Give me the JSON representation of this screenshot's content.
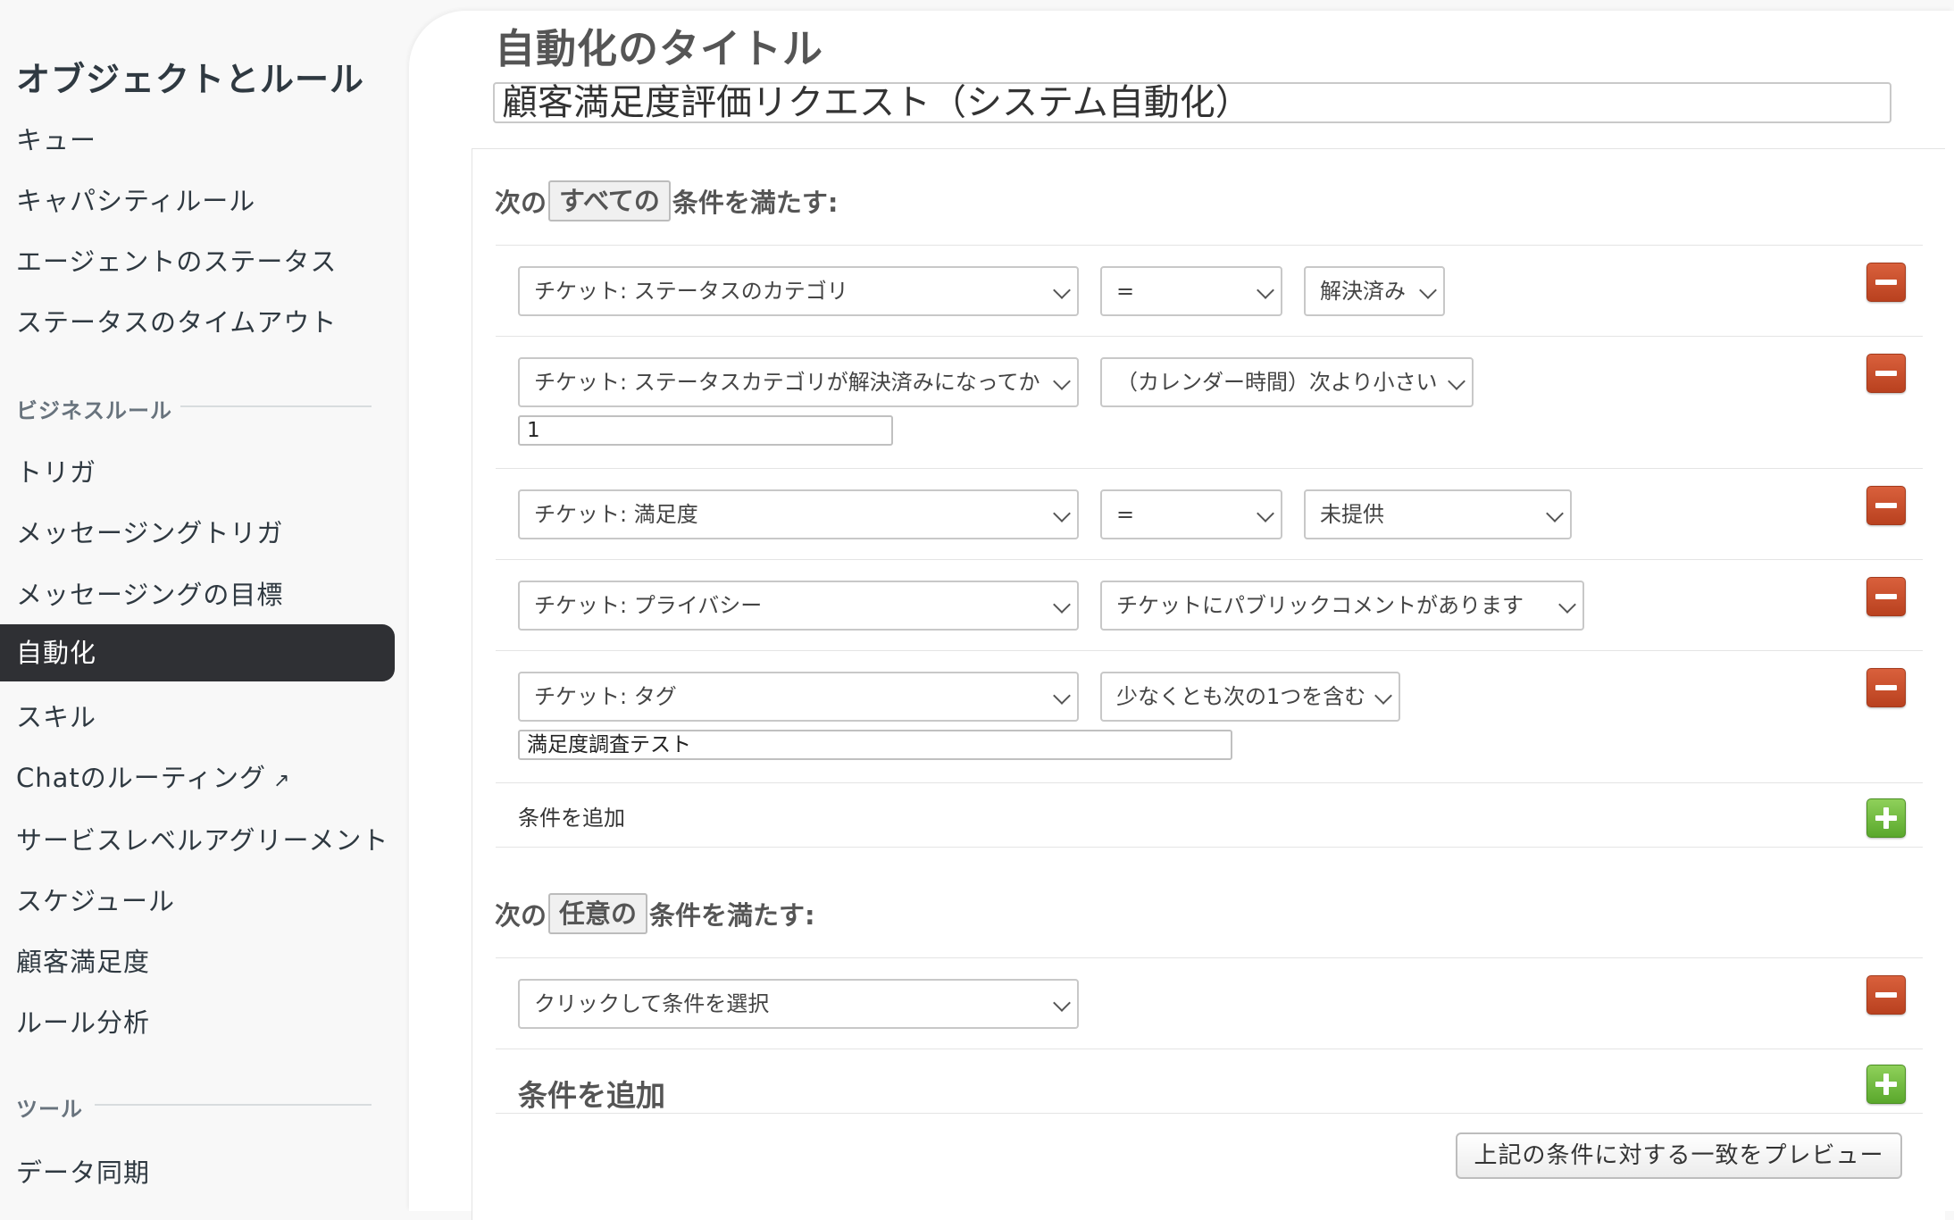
{
  "sidebar": {
    "title": "オブジェクトとルール",
    "items_top": [
      "キュー",
      "キャパシティルール",
      "エージェントのステータス",
      "ステータスのタイムアウト"
    ],
    "section_business": "ビジネスルール",
    "items_business": [
      "トリガ",
      "メッセージングトリガ",
      "メッセージングの目標",
      "自動化",
      "スキル",
      "Chatのルーティング",
      "サービスレベルアグリーメント",
      "スケジュール",
      "顧客満足度",
      "ルール分析"
    ],
    "active_item": "自動化",
    "external_link_icon": "↗",
    "section_tools": "ツール",
    "items_tools": [
      "データ同期"
    ]
  },
  "form": {
    "title_label": "自動化のタイトル",
    "title_value": "顧客満足度評価リクエスト（システム自動化）"
  },
  "all_section": {
    "prefix": "次の",
    "selector": "すべての",
    "suffix": "条件を満たす:",
    "conditions": [
      {
        "field": "チケット: ステータスのカテゴリ",
        "operator": "=",
        "value": "解決済み"
      },
      {
        "field": "チケット: ステータスカテゴリが解決済みになってか",
        "operator": "（カレンダー時間）次より小さい",
        "input": "1"
      },
      {
        "field": "チケット: 満足度",
        "operator": "=",
        "value": "未提供"
      },
      {
        "field": "チケット: プライバシー",
        "operator": "チケットにパブリックコメントがあります"
      },
      {
        "field": "チケット: タグ",
        "operator": "少なくとも次の1つを含む",
        "input": "満足度調査テスト"
      }
    ],
    "add_label": "条件を追加"
  },
  "any_section": {
    "prefix": "次の",
    "selector": "任意の",
    "suffix": "条件を満たす:",
    "conditions": [
      {
        "field": "クリックして条件を選択"
      }
    ],
    "add_label": "条件を追加"
  },
  "preview_label": "上記の条件に対する一致をプレビュー",
  "colors": {
    "active_bg": "#2f3034",
    "remove_button": "#c9502e",
    "add_button": "#6fbb3c"
  }
}
